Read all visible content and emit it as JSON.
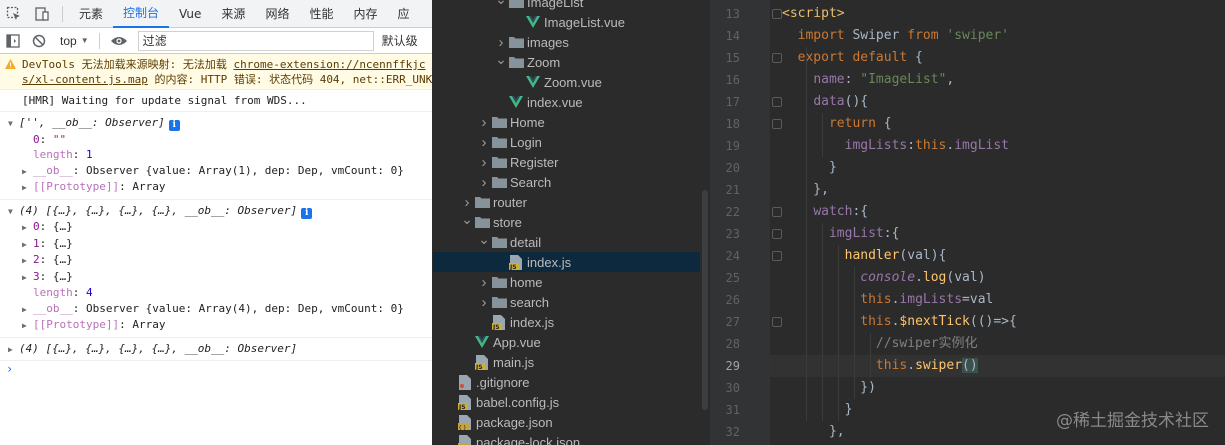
{
  "devtools": {
    "tabs": [
      "元素",
      "控制台",
      "Vue",
      "来源",
      "网络",
      "性能",
      "内存",
      "应"
    ],
    "active_tab": "控制台",
    "context": "top",
    "filter_placeholder": "过滤",
    "levels_label": "默认级",
    "warning": {
      "line1_prefix": "DevTools 无法加载来源映射: 无法加载 ",
      "line1_link": "chrome-extension://ncennffkjc",
      "line2_link": "s/xl-content.js.map",
      "line2_suffix": " 的内容: HTTP 错误: 状态代码 404, net::ERR_UNK"
    },
    "hmr_message": "[HMR] Waiting for update signal from WDS...",
    "log1": {
      "summary": "['', __ob__: Observer]",
      "items": [
        {
          "key": "0",
          "value": "\"\"",
          "kind": "str"
        },
        {
          "key": "length",
          "value": "1",
          "kind": "num",
          "dim": true
        },
        {
          "key": "__ob__",
          "value": "Observer {value: Array(1), dep: Dep, vmCount: 0}",
          "kind": "plain",
          "dim": true,
          "arrow": true
        },
        {
          "key": "[[Prototype]]",
          "value": "Array",
          "kind": "plain",
          "dim": true,
          "arrow": true
        }
      ]
    },
    "log2": {
      "summary": "(4) [{…}, {…}, {…}, {…}, __ob__: Observer]",
      "items": [
        {
          "key": "0",
          "value": "{…}",
          "kind": "plain",
          "arrow": true
        },
        {
          "key": "1",
          "value": "{…}",
          "kind": "plain",
          "arrow": true
        },
        {
          "key": "2",
          "value": "{…}",
          "kind": "plain",
          "arrow": true
        },
        {
          "key": "3",
          "value": "{…}",
          "kind": "plain",
          "arrow": true
        },
        {
          "key": "length",
          "value": "4",
          "kind": "num",
          "dim": true
        },
        {
          "key": "__ob__",
          "value": "Observer {value: Array(4), dep: Dep, vmCount: 0}",
          "kind": "plain",
          "dim": true,
          "arrow": true
        },
        {
          "key": "[[Prototype]]",
          "value": "Array",
          "kind": "plain",
          "dim": true,
          "arrow": true
        }
      ]
    },
    "log3": {
      "summary": "(4) [{…}, {…}, {…}, {…}, __ob__: Observer]"
    },
    "prompt": "›"
  },
  "tree": {
    "rows": [
      {
        "label": "ImageList",
        "depth": 5,
        "type": "folder",
        "arrow": "open"
      },
      {
        "label": "ImageList.vue",
        "depth": 6,
        "type": "vue",
        "arrow": "none"
      },
      {
        "label": "images",
        "depth": 5,
        "type": "folder",
        "arrow": "closed"
      },
      {
        "label": "Zoom",
        "depth": 5,
        "type": "folder",
        "arrow": "open"
      },
      {
        "label": "Zoom.vue",
        "depth": 6,
        "type": "vue",
        "arrow": "none"
      },
      {
        "label": "index.vue",
        "depth": 5,
        "type": "vue",
        "arrow": "none"
      },
      {
        "label": "Home",
        "depth": 4,
        "type": "folder",
        "arrow": "closed"
      },
      {
        "label": "Login",
        "depth": 4,
        "type": "folder",
        "arrow": "closed"
      },
      {
        "label": "Register",
        "depth": 4,
        "type": "folder",
        "arrow": "closed"
      },
      {
        "label": "Search",
        "depth": 4,
        "type": "folder",
        "arrow": "closed"
      },
      {
        "label": "router",
        "depth": 3,
        "type": "folder",
        "arrow": "closed"
      },
      {
        "label": "store",
        "depth": 3,
        "type": "folder",
        "arrow": "open"
      },
      {
        "label": "detail",
        "depth": 4,
        "type": "folder",
        "arrow": "open"
      },
      {
        "label": "index.js",
        "depth": 5,
        "type": "js",
        "arrow": "none",
        "selected": true
      },
      {
        "label": "home",
        "depth": 4,
        "type": "folder",
        "arrow": "closed"
      },
      {
        "label": "search",
        "depth": 4,
        "type": "folder",
        "arrow": "closed"
      },
      {
        "label": "index.js",
        "depth": 4,
        "type": "js",
        "arrow": "none"
      },
      {
        "label": "App.vue",
        "depth": 3,
        "type": "vue",
        "arrow": "none"
      },
      {
        "label": "main.js",
        "depth": 3,
        "type": "js",
        "arrow": "none"
      },
      {
        "label": ".gitignore",
        "depth": 2,
        "type": "git",
        "arrow": "none"
      },
      {
        "label": "babel.config.js",
        "depth": 2,
        "type": "js",
        "arrow": "none"
      },
      {
        "label": "package.json",
        "depth": 2,
        "type": "json",
        "arrow": "none"
      },
      {
        "label": "package-lock.json",
        "depth": 2,
        "type": "json",
        "arrow": "none"
      }
    ]
  },
  "editor": {
    "current_line": 29,
    "lines": [
      {
        "n": "13",
        "tokens": [
          {
            "t": "<script>",
            "c": "tag"
          }
        ]
      },
      {
        "n": "14",
        "tokens": [
          {
            "t": "  "
          },
          {
            "t": "import",
            "c": "kw"
          },
          {
            "t": " Swiper "
          },
          {
            "t": "from",
            "c": "kw"
          },
          {
            "t": " "
          },
          {
            "t": "'swiper'",
            "c": "str"
          }
        ]
      },
      {
        "n": "15",
        "tokens": [
          {
            "t": "  "
          },
          {
            "t": "export default",
            "c": "kw"
          },
          {
            "t": " {"
          }
        ]
      },
      {
        "n": "16",
        "tokens": [
          {
            "t": "    "
          },
          {
            "t": "name",
            "c": "prop"
          },
          {
            "t": ": "
          },
          {
            "t": "\"ImageList\"",
            "c": "str"
          },
          {
            "t": ","
          }
        ]
      },
      {
        "n": "17",
        "tokens": [
          {
            "t": "    "
          },
          {
            "t": "data",
            "c": "prop"
          },
          {
            "t": "(){"
          }
        ]
      },
      {
        "n": "18",
        "tokens": [
          {
            "t": "      "
          },
          {
            "t": "return",
            "c": "kw"
          },
          {
            "t": " {"
          }
        ]
      },
      {
        "n": "19",
        "tokens": [
          {
            "t": "        "
          },
          {
            "t": "imgLists",
            "c": "prop"
          },
          {
            "t": ":"
          },
          {
            "t": "this",
            "c": "kw"
          },
          {
            "t": "."
          },
          {
            "t": "imgList",
            "c": "prop"
          }
        ]
      },
      {
        "n": "20",
        "tokens": [
          {
            "t": "      }"
          }
        ]
      },
      {
        "n": "21",
        "tokens": [
          {
            "t": "    },"
          }
        ]
      },
      {
        "n": "22",
        "tokens": [
          {
            "t": "    "
          },
          {
            "t": "watch",
            "c": "prop"
          },
          {
            "t": ":{"
          }
        ]
      },
      {
        "n": "23",
        "tokens": [
          {
            "t": "      "
          },
          {
            "t": "imgList",
            "c": "prop"
          },
          {
            "t": ":{"
          }
        ]
      },
      {
        "n": "24",
        "tokens": [
          {
            "t": "        "
          },
          {
            "t": "handler",
            "c": "fn"
          },
          {
            "t": "(val){"
          }
        ]
      },
      {
        "n": "25",
        "tokens": [
          {
            "t": "          "
          },
          {
            "t": "console",
            "c": "cons"
          },
          {
            "t": "."
          },
          {
            "t": "log",
            "c": "fn"
          },
          {
            "t": "(val)"
          }
        ]
      },
      {
        "n": "26",
        "tokens": [
          {
            "t": "          "
          },
          {
            "t": "this",
            "c": "kw"
          },
          {
            "t": "."
          },
          {
            "t": "imgLists",
            "c": "prop"
          },
          {
            "t": "=val"
          }
        ]
      },
      {
        "n": "27",
        "tokens": [
          {
            "t": "          "
          },
          {
            "t": "this",
            "c": "kw"
          },
          {
            "t": "."
          },
          {
            "t": "$nextTick",
            "c": "fn"
          },
          {
            "t": "(()=>{"
          }
        ]
      },
      {
        "n": "28",
        "tokens": [
          {
            "t": "            "
          },
          {
            "t": "//swiper实例化",
            "c": "com"
          }
        ]
      },
      {
        "n": "29",
        "tokens": [
          {
            "t": "            "
          },
          {
            "t": "this",
            "c": "kw"
          },
          {
            "t": "."
          },
          {
            "t": "swiper",
            "c": "fn"
          },
          {
            "t": "()",
            "c": "hl"
          }
        ]
      },
      {
        "n": "30",
        "tokens": [
          {
            "t": "          })"
          }
        ]
      },
      {
        "n": "31",
        "tokens": [
          {
            "t": "        }"
          }
        ]
      },
      {
        "n": "32",
        "tokens": [
          {
            "t": "      },"
          }
        ]
      }
    ]
  },
  "watermark": "@稀土掘金技术社区",
  "colors": {
    "accent": "#1a73e8",
    "editor_bg": "#2b2b2b",
    "selection": "#0d293e",
    "vue_green": "#41b883"
  }
}
